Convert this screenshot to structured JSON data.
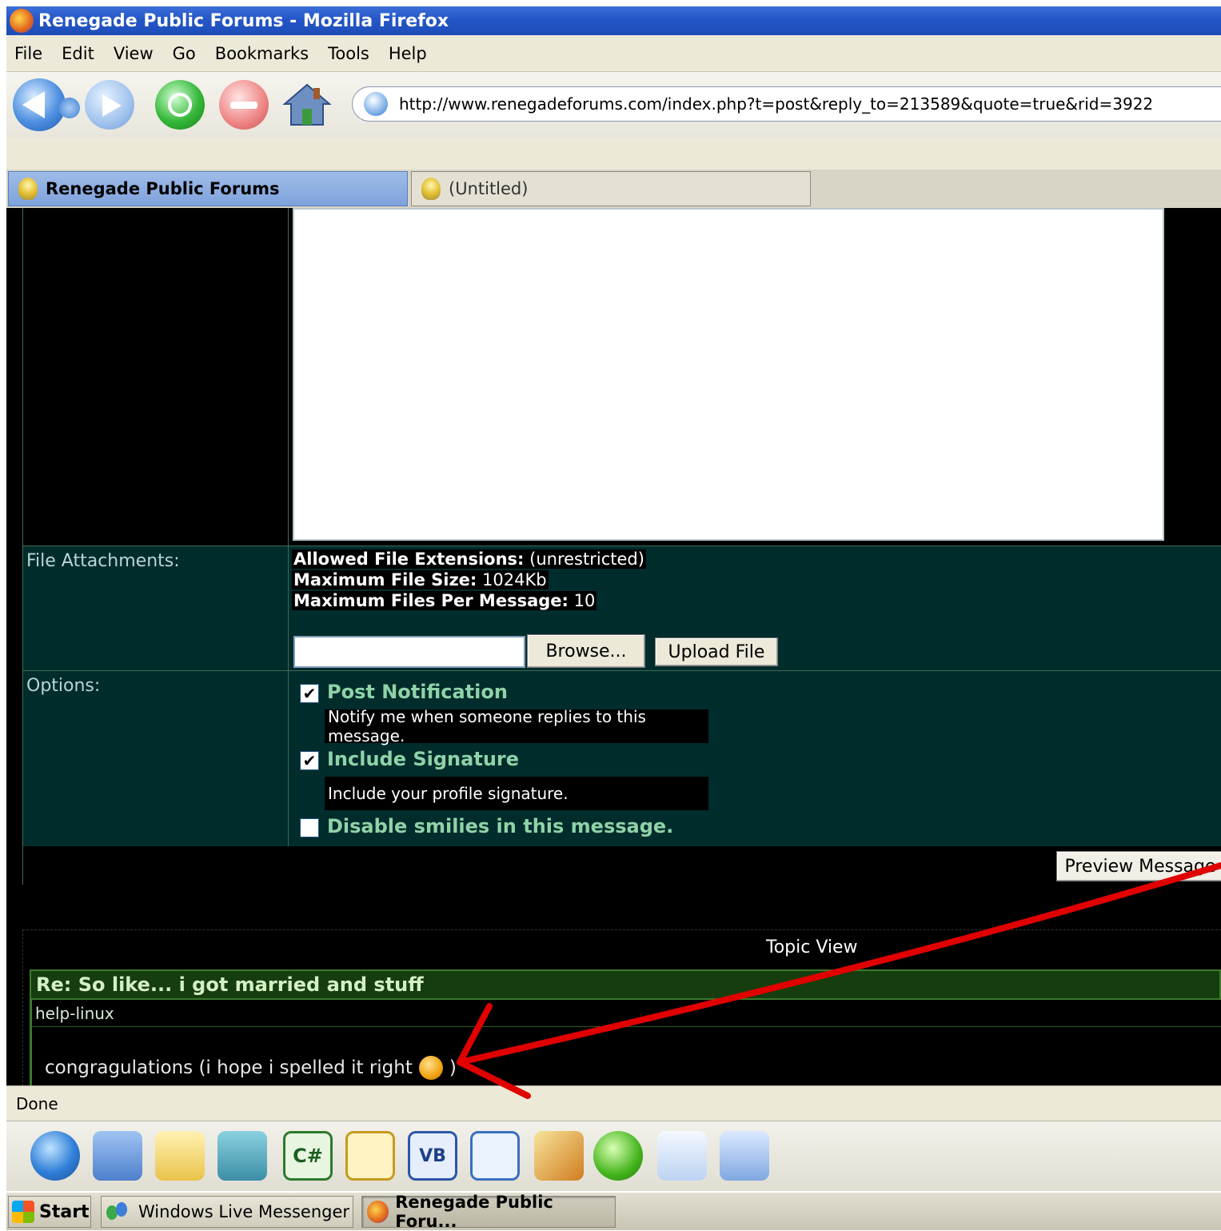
{
  "window": {
    "title": "Renegade Public Forums - Mozilla Firefox"
  },
  "menu": {
    "items": [
      "File",
      "Edit",
      "View",
      "Go",
      "Bookmarks",
      "Tools",
      "Help"
    ]
  },
  "navigation": {
    "url": "http://www.renegadeforums.com/index.php?t=post&reply_to=213589&quote=true&rid=3922",
    "icons": [
      "back-icon",
      "forward-icon",
      "reload-icon",
      "stop-icon",
      "home-icon",
      "globe-icon"
    ]
  },
  "tabs": [
    {
      "label": "Renegade Public Forums",
      "active": true
    },
    {
      "label": "(Untitled)",
      "active": false
    }
  ],
  "form": {
    "attachments": {
      "label": "File Attachments:",
      "allowed_ext_label": "Allowed File Extensions:",
      "allowed_ext_value": "(unrestricted)",
      "max_size_label": "Maximum File Size:",
      "max_size_value": "1024Kb",
      "max_files_label": "Maximum Files Per Message:",
      "max_files_value": "10",
      "file_input_value": "",
      "browse_label": "Browse...",
      "upload_label": "Upload File"
    },
    "options": {
      "label": "Options:",
      "post_notification": {
        "label": "Post Notification",
        "description": "Notify me when someone replies to this message.",
        "checked": true
      },
      "include_signature": {
        "label": "Include Signature",
        "description": "Include your profile signature.",
        "checked": true
      },
      "disable_smilies": {
        "label": "Disable smilies in this message.",
        "checked": false
      }
    },
    "preview_button_label": "Preview Message"
  },
  "topic": {
    "heading": "Topic View",
    "post_title": "Re: So like... i got married and stuff",
    "author": "help-linux",
    "body_text": "congragulations (i hope i spelled it right",
    "body_suffix": ")"
  },
  "status": {
    "text": "Done"
  },
  "quicklaunch": {
    "icons": [
      "internet-icon",
      "network-icon",
      "mail-icon",
      "components-icon",
      "csharp-icon",
      "crosshair-icon",
      "vb-icon",
      "remote-desktop-icon",
      "quill-icon",
      "music-player-icon",
      "notepad-pencil-icon",
      "notepad-icon"
    ]
  },
  "taskbar": {
    "start_label": "Start",
    "tasks": [
      "Windows Live Messenger",
      "Renegade Public Foru..."
    ]
  },
  "colors": {
    "form_row_bg": "#012c2c",
    "option_label": "#8fd3a8",
    "post_title_bg": "#163d10",
    "annotation_arrow": "#e00000"
  }
}
